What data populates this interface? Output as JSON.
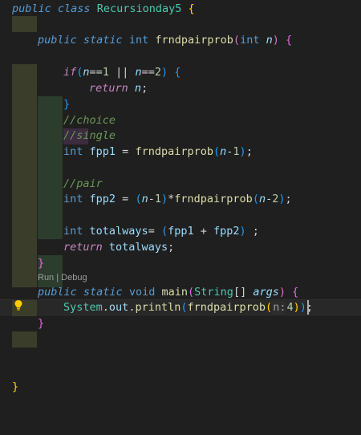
{
  "editor": {
    "codelens": {
      "run": "Run",
      "separator": " | ",
      "debug": "Debug"
    },
    "lines": {
      "l1": {
        "kw1": "public",
        "kw2": "class",
        "cls": "Recursionday5",
        "brace": "{"
      },
      "l2": {
        "kw1": "public",
        "kw2": "static",
        "type": "int",
        "fn": "frndpairprob",
        "open": "(",
        "ptype": "int",
        "param": "n",
        "close": ")",
        "brace": "{"
      },
      "l3": {
        "kw": "if",
        "open": "(",
        "v1": "n",
        "op1": "==",
        "n1": "1",
        "or": " || ",
        "v2": "n",
        "op2": "==",
        "n2": "2",
        "close": ")",
        "brace": "{"
      },
      "l4": {
        "kw": "return",
        "v": "n",
        "semi": ";"
      },
      "l5": {
        "brace": "}"
      },
      "l6": {
        "comment": "//choice"
      },
      "l7": {
        "comment": "//single"
      },
      "l8": {
        "type": "int",
        "name": "fpp1",
        "eq": " = ",
        "fn": "frndpairprob",
        "open": "(",
        "v": "n",
        "minus": "-",
        "num": "1",
        "close": ")",
        "semi": ";"
      },
      "l9": {
        "comment": "//pair"
      },
      "l10": {
        "type": "int",
        "name": "fpp2",
        "eq": " = ",
        "open1": "(",
        "v1": "n",
        "minus1": "-",
        "num1": "1",
        "close1": ")",
        "star": "*",
        "fn": "frndpairprob",
        "open2": "(",
        "v2": "n",
        "minus2": "-",
        "num2": "2",
        "close2": ")",
        "semi": ";"
      },
      "l11": {
        "type": "int",
        "name": "totalways",
        "eq": "= ",
        "open": "(",
        "a": "fpp1",
        "plus": " + ",
        "b": "fpp2",
        "close": ")",
        "semi": " ;"
      },
      "l12": {
        "kw": "return",
        "name": "totalways",
        "semi": ";"
      },
      "l13": {
        "brace": "}"
      },
      "l14": {
        "kw1": "public",
        "kw2": "static",
        "type": "void",
        "fn": "main",
        "open": "(",
        "ptype": "String",
        "arr": "[]",
        "param": "args",
        "close": ")",
        "brace": "{"
      },
      "l15": {
        "cls": "System",
        "dot1": ".",
        "field": "out",
        "dot2": ".",
        "fn1": "println",
        "open1": "(",
        "fn2": "frndpairprob",
        "open2": "(",
        "hint": "n:",
        "num": "4",
        "close2": ")",
        "close1": ")",
        "semi": ";"
      },
      "l16": {
        "brace": "}"
      },
      "l17": {
        "brace": "}"
      }
    }
  }
}
